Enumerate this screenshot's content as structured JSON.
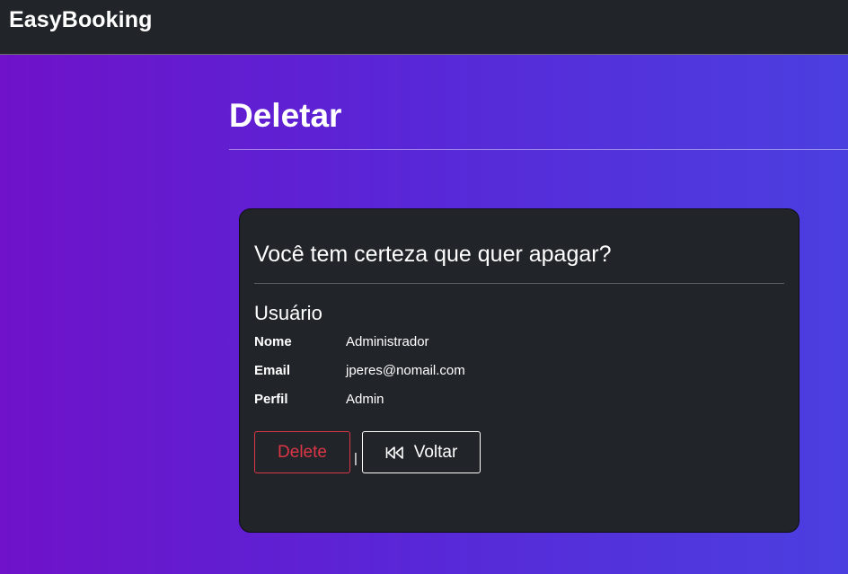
{
  "navbar": {
    "brand": "EasyBooking"
  },
  "page": {
    "title": "Deletar"
  },
  "card": {
    "question": "Você tem certeza que quer apagar?",
    "section_heading": "Usuário",
    "fields": [
      {
        "label": "Nome",
        "value": "Administrador"
      },
      {
        "label": "Email",
        "value": "jperes@nomail.com"
      },
      {
        "label": "Perfil",
        "value": "Admin"
      }
    ],
    "actions": {
      "delete_label": "Delete",
      "separator": "|",
      "back_label": "Voltar",
      "back_icon": "rewind-icon"
    }
  },
  "colors": {
    "navbar_bg": "#212529",
    "card_bg": "#212529",
    "danger": "#dc3545",
    "gradient_start": "#6f12c9",
    "gradient_end": "#4b3fe0"
  }
}
